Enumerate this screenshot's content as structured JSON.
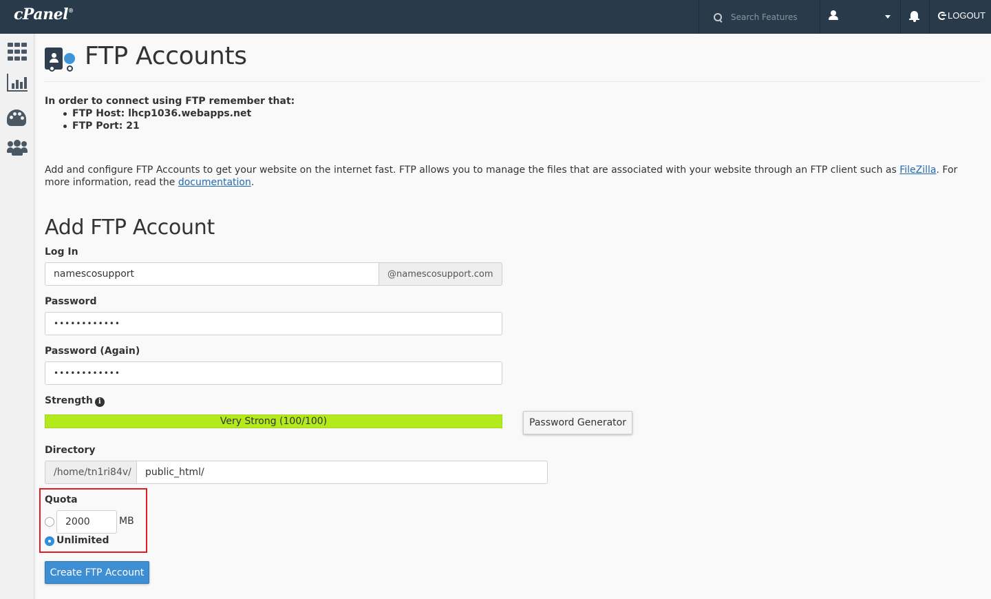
{
  "topbar": {
    "logo": "cPanel",
    "logo_mark": "®",
    "search_placeholder": "Search Features",
    "logout_label": "LOGOUT"
  },
  "sidebar": {
    "items": [
      {
        "icon": "grid-icon"
      },
      {
        "icon": "stats-icon"
      },
      {
        "icon": "palette-icon"
      },
      {
        "icon": "users-icon"
      }
    ]
  },
  "page": {
    "title": "FTP Accounts",
    "icon": "ftp-accounts-icon"
  },
  "ftp_note": {
    "intro": "In order to connect using FTP remember that:",
    "host": "FTP Host: lhcp1036.webapps.net",
    "port": "FTP Port: 21"
  },
  "description": {
    "part1": "Add and configure FTP Accounts to get your website on the internet fast. FTP allows you to manage the files that are associated with your website through an FTP client such as ",
    "filezilla_link": "FileZilla",
    "part2": ". For more information, read the ",
    "doc_link": "documentation",
    "part3": "."
  },
  "form": {
    "section_title": "Add FTP Account",
    "login_label": "Log In",
    "login_value": "namescosupport",
    "login_domain": "@namescosupport.com",
    "password_label": "Password",
    "password_value": "••••••••••••",
    "password_again_label": "Password (Again)",
    "password_again_value": "••••••••••••",
    "strength_label": "Strength",
    "strength_text": "Very Strong (100/100)",
    "strength_score": 100,
    "strength_color": "#b3ea1b",
    "password_generator_label": "Password Generator",
    "directory_label": "Directory",
    "directory_prefix": "/home/tn1ri84v/",
    "directory_value": "public_html/",
    "quota_label": "Quota",
    "quota_value": "2000",
    "quota_unit": "MB",
    "quota_unlimited_label": "Unlimited",
    "quota_selected": "Unlimited",
    "create_button_label": "Create FTP Account"
  },
  "colors": {
    "topbar": "#293a4a",
    "accent": "#3e8ed4",
    "highlight_box": "#e01b22"
  }
}
